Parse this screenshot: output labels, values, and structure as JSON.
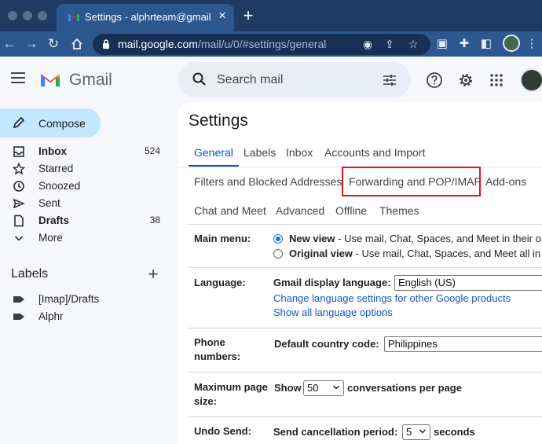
{
  "browser": {
    "tab_title": "Settings - alphrteam@gmail.co",
    "url_host": "mail.google.com",
    "url_path": "/mail/u/0/#settings/general"
  },
  "header": {
    "product": "Gmail",
    "search_placeholder": "Search mail"
  },
  "nav": {
    "compose": "Compose",
    "items": [
      {
        "label": "Inbox",
        "count": "524",
        "icon": "inbox-icon"
      },
      {
        "label": "Starred",
        "count": "",
        "icon": "star-icon"
      },
      {
        "label": "Snoozed",
        "count": "",
        "icon": "clock-icon"
      },
      {
        "label": "Sent",
        "count": "",
        "icon": "send-icon"
      },
      {
        "label": "Drafts",
        "count": "38",
        "icon": "draft-icon"
      },
      {
        "label": "More",
        "count": "",
        "icon": "chevron-down-icon"
      }
    ],
    "labels_heading": "Labels",
    "labels": [
      {
        "label": "[Imap]/Drafts",
        "icon": "label-icon"
      },
      {
        "label": "Alphr",
        "icon": "label-icon"
      }
    ]
  },
  "settings": {
    "title": "Settings",
    "tabs": [
      "General",
      "Labels",
      "Inbox",
      "Accounts and Import",
      "Filters and Blocked Addresses",
      "Forwarding and POP/IMAP",
      "Add-ons",
      "Chat and Meet",
      "Advanced",
      "Offline",
      "Themes"
    ],
    "main_menu": {
      "label": "Main menu:",
      "new_view": "New view",
      "new_view_desc": " - Use mail, Chat, Spaces, and Meet in their o",
      "original_view": "Original view",
      "original_view_desc": " - Use mail, Chat, Spaces, and Meet all in"
    },
    "language": {
      "label": "Language:",
      "display_label": "Gmail display language:",
      "display_value": "English (US)",
      "link_change": "Change language settings for other Google products",
      "link_show": "Show all language options"
    },
    "phone": {
      "label_line1": "Phone",
      "label_line2": "numbers:",
      "country_label": "Default country code:",
      "country_value": "Philippines"
    },
    "page_size": {
      "label_line1": "Maximum page",
      "label_line2": "size:",
      "show": "Show",
      "value": "50",
      "suffix": "conversations per page"
    },
    "undo_send": {
      "label": "Undo Send:",
      "period_label": "Send cancellation period:",
      "value": "5",
      "suffix": "seconds"
    }
  }
}
